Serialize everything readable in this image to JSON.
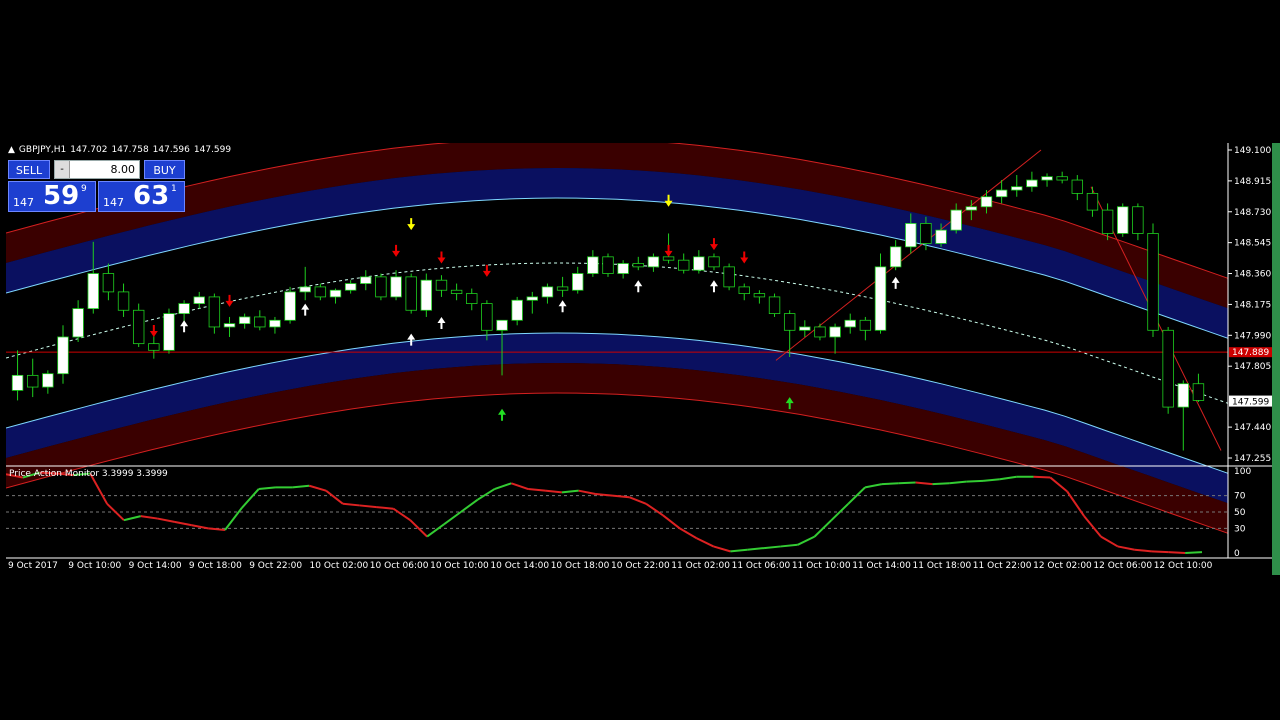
{
  "symbol_header": {
    "symbol": "GBPJPY,H1",
    "open": "147.702",
    "high": "147.758",
    "low": "147.596",
    "close": "147.599"
  },
  "trade_panel": {
    "sell_label": "SELL",
    "buy_label": "BUY",
    "lot_minus": "-",
    "lot_value": "8.00",
    "sell_quote": {
      "big": "147",
      "large": "59",
      "sup": "9"
    },
    "buy_quote": {
      "big": "147",
      "large": "63",
      "sup": "1"
    }
  },
  "price_axis": {
    "ticks": [
      "149.100",
      "148.915",
      "148.730",
      "148.545",
      "148.360",
      "148.175",
      "147.990",
      "147.805",
      "147.440",
      "147.255"
    ],
    "bid_line_label": "147.889",
    "current_price_label": "147.599"
  },
  "indicator": {
    "label": "Price Action Monitor 3.3999 3.3999",
    "levels": [
      "100",
      "70",
      "50",
      "30",
      "0"
    ]
  },
  "time_axis": {
    "labels": [
      "9 Oct 2017",
      "9 Oct 10:00",
      "9 Oct 14:00",
      "9 Oct 18:00",
      "9 Oct 22:00",
      "10 Oct 02:00",
      "10 Oct 06:00",
      "10 Oct 10:00",
      "10 Oct 14:00",
      "10 Oct 18:00",
      "10 Oct 22:00",
      "11 Oct 02:00",
      "11 Oct 06:00",
      "11 Oct 10:00",
      "11 Oct 14:00",
      "11 Oct 18:00",
      "11 Oct 22:00",
      "12 Oct 02:00",
      "12 Oct 06:00",
      "12 Oct 10:00"
    ]
  },
  "colors": {
    "background": "#000000",
    "bull_candle": "#ffffff",
    "bear_candle": "#000000",
    "wick_up": "#1fd01f",
    "band_outer": "#3a0000",
    "band_inner": "#0a1060",
    "band_line_red": "#d42020",
    "band_line_cyan": "#7fd8ff",
    "indicator_up": "#33cc33",
    "indicator_down": "#dd2222",
    "bid_line": "#cc0000",
    "sell_button": "#1d3fd0"
  },
  "chart_data": {
    "type": "candlestick",
    "symbol": "GBPJPY",
    "timeframe": "H1",
    "y_range": [
      147.255,
      149.1
    ],
    "candles": [
      {
        "o": 147.66,
        "h": 147.9,
        "l": 147.6,
        "c": 147.75
      },
      {
        "o": 147.75,
        "h": 147.85,
        "l": 147.62,
        "c": 147.68
      },
      {
        "o": 147.68,
        "h": 147.78,
        "l": 147.64,
        "c": 147.76
      },
      {
        "o": 147.76,
        "h": 148.05,
        "l": 147.7,
        "c": 147.98
      },
      {
        "o": 147.98,
        "h": 148.2,
        "l": 147.95,
        "c": 148.15
      },
      {
        "o": 148.15,
        "h": 148.55,
        "l": 148.12,
        "c": 148.36
      },
      {
        "o": 148.36,
        "h": 148.42,
        "l": 148.2,
        "c": 148.25
      },
      {
        "o": 148.25,
        "h": 148.3,
        "l": 148.1,
        "c": 148.14
      },
      {
        "o": 148.14,
        "h": 148.18,
        "l": 147.92,
        "c": 147.94
      },
      {
        "o": 147.94,
        "h": 148.0,
        "l": 147.85,
        "c": 147.9
      },
      {
        "o": 147.9,
        "h": 148.15,
        "l": 147.88,
        "c": 148.12
      },
      {
        "o": 148.12,
        "h": 148.2,
        "l": 148.05,
        "c": 148.18
      },
      {
        "o": 148.18,
        "h": 148.25,
        "l": 148.15,
        "c": 148.22
      },
      {
        "o": 148.22,
        "h": 148.24,
        "l": 148.0,
        "c": 148.04
      },
      {
        "o": 148.04,
        "h": 148.1,
        "l": 147.98,
        "c": 148.06
      },
      {
        "o": 148.06,
        "h": 148.12,
        "l": 148.03,
        "c": 148.1
      },
      {
        "o": 148.1,
        "h": 148.14,
        "l": 148.02,
        "c": 148.04
      },
      {
        "o": 148.04,
        "h": 148.1,
        "l": 148.0,
        "c": 148.08
      },
      {
        "o": 148.08,
        "h": 148.28,
        "l": 148.06,
        "c": 148.25
      },
      {
        "o": 148.25,
        "h": 148.4,
        "l": 148.2,
        "c": 148.28
      },
      {
        "o": 148.28,
        "h": 148.3,
        "l": 148.2,
        "c": 148.22
      },
      {
        "o": 148.22,
        "h": 148.27,
        "l": 148.18,
        "c": 148.26
      },
      {
        "o": 148.26,
        "h": 148.32,
        "l": 148.24,
        "c": 148.3
      },
      {
        "o": 148.3,
        "h": 148.38,
        "l": 148.26,
        "c": 148.34
      },
      {
        "o": 148.34,
        "h": 148.36,
        "l": 148.2,
        "c": 148.22
      },
      {
        "o": 148.22,
        "h": 148.38,
        "l": 148.2,
        "c": 148.34
      },
      {
        "o": 148.34,
        "h": 148.36,
        "l": 148.12,
        "c": 148.14
      },
      {
        "o": 148.14,
        "h": 148.36,
        "l": 148.1,
        "c": 148.32
      },
      {
        "o": 148.32,
        "h": 148.35,
        "l": 148.22,
        "c": 148.26
      },
      {
        "o": 148.26,
        "h": 148.3,
        "l": 148.2,
        "c": 148.24
      },
      {
        "o": 148.24,
        "h": 148.27,
        "l": 148.14,
        "c": 148.18
      },
      {
        "o": 148.18,
        "h": 148.2,
        "l": 147.96,
        "c": 148.02
      },
      {
        "o": 148.02,
        "h": 148.05,
        "l": 147.75,
        "c": 148.08
      },
      {
        "o": 148.08,
        "h": 148.22,
        "l": 148.05,
        "c": 148.2
      },
      {
        "o": 148.2,
        "h": 148.25,
        "l": 148.12,
        "c": 148.22
      },
      {
        "o": 148.22,
        "h": 148.3,
        "l": 148.18,
        "c": 148.28
      },
      {
        "o": 148.28,
        "h": 148.34,
        "l": 148.22,
        "c": 148.26
      },
      {
        "o": 148.26,
        "h": 148.4,
        "l": 148.24,
        "c": 148.36
      },
      {
        "o": 148.36,
        "h": 148.5,
        "l": 148.34,
        "c": 148.46
      },
      {
        "o": 148.46,
        "h": 148.48,
        "l": 148.34,
        "c": 148.36
      },
      {
        "o": 148.36,
        "h": 148.44,
        "l": 148.33,
        "c": 148.42
      },
      {
        "o": 148.42,
        "h": 148.46,
        "l": 148.38,
        "c": 148.4
      },
      {
        "o": 148.4,
        "h": 148.48,
        "l": 148.37,
        "c": 148.46
      },
      {
        "o": 148.46,
        "h": 148.6,
        "l": 148.42,
        "c": 148.44
      },
      {
        "o": 148.44,
        "h": 148.48,
        "l": 148.36,
        "c": 148.38
      },
      {
        "o": 148.38,
        "h": 148.5,
        "l": 148.36,
        "c": 148.46
      },
      {
        "o": 148.46,
        "h": 148.48,
        "l": 148.38,
        "c": 148.4
      },
      {
        "o": 148.4,
        "h": 148.42,
        "l": 148.26,
        "c": 148.28
      },
      {
        "o": 148.28,
        "h": 148.3,
        "l": 148.2,
        "c": 148.24
      },
      {
        "o": 148.24,
        "h": 148.26,
        "l": 148.18,
        "c": 148.22
      },
      {
        "o": 148.22,
        "h": 148.24,
        "l": 148.1,
        "c": 148.12
      },
      {
        "o": 148.12,
        "h": 148.14,
        "l": 147.86,
        "c": 148.02
      },
      {
        "o": 148.02,
        "h": 148.08,
        "l": 147.98,
        "c": 148.04
      },
      {
        "o": 148.04,
        "h": 148.06,
        "l": 147.96,
        "c": 147.98
      },
      {
        "o": 147.98,
        "h": 148.06,
        "l": 147.88,
        "c": 148.04
      },
      {
        "o": 148.04,
        "h": 148.12,
        "l": 148.0,
        "c": 148.08
      },
      {
        "o": 148.08,
        "h": 148.1,
        "l": 147.96,
        "c": 148.02
      },
      {
        "o": 148.02,
        "h": 148.48,
        "l": 148.0,
        "c": 148.4
      },
      {
        "o": 148.4,
        "h": 148.56,
        "l": 148.38,
        "c": 148.52
      },
      {
        "o": 148.52,
        "h": 148.72,
        "l": 148.48,
        "c": 148.66
      },
      {
        "o": 148.66,
        "h": 148.7,
        "l": 148.5,
        "c": 148.54
      },
      {
        "o": 148.54,
        "h": 148.66,
        "l": 148.52,
        "c": 148.62
      },
      {
        "o": 148.62,
        "h": 148.78,
        "l": 148.6,
        "c": 148.74
      },
      {
        "o": 148.74,
        "h": 148.8,
        "l": 148.68,
        "c": 148.76
      },
      {
        "o": 148.76,
        "h": 148.86,
        "l": 148.72,
        "c": 148.82
      },
      {
        "o": 148.82,
        "h": 148.92,
        "l": 148.78,
        "c": 148.86
      },
      {
        "o": 148.86,
        "h": 148.95,
        "l": 148.82,
        "c": 148.88
      },
      {
        "o": 148.88,
        "h": 148.97,
        "l": 148.85,
        "c": 148.92
      },
      {
        "o": 148.92,
        "h": 148.96,
        "l": 148.88,
        "c": 148.94
      },
      {
        "o": 148.94,
        "h": 148.97,
        "l": 148.9,
        "c": 148.92
      },
      {
        "o": 148.92,
        "h": 148.95,
        "l": 148.8,
        "c": 148.84
      },
      {
        "o": 148.84,
        "h": 148.88,
        "l": 148.7,
        "c": 148.74
      },
      {
        "o": 148.74,
        "h": 148.78,
        "l": 148.56,
        "c": 148.6
      },
      {
        "o": 148.6,
        "h": 148.78,
        "l": 148.58,
        "c": 148.76
      },
      {
        "o": 148.76,
        "h": 148.78,
        "l": 148.56,
        "c": 148.6
      },
      {
        "o": 148.6,
        "h": 148.66,
        "l": 147.98,
        "c": 148.02
      },
      {
        "o": 148.02,
        "h": 148.04,
        "l": 147.52,
        "c": 147.56
      },
      {
        "o": 147.56,
        "h": 147.72,
        "l": 147.3,
        "c": 147.7
      },
      {
        "o": 147.7,
        "h": 147.76,
        "l": 147.59,
        "c": 147.6
      }
    ]
  }
}
